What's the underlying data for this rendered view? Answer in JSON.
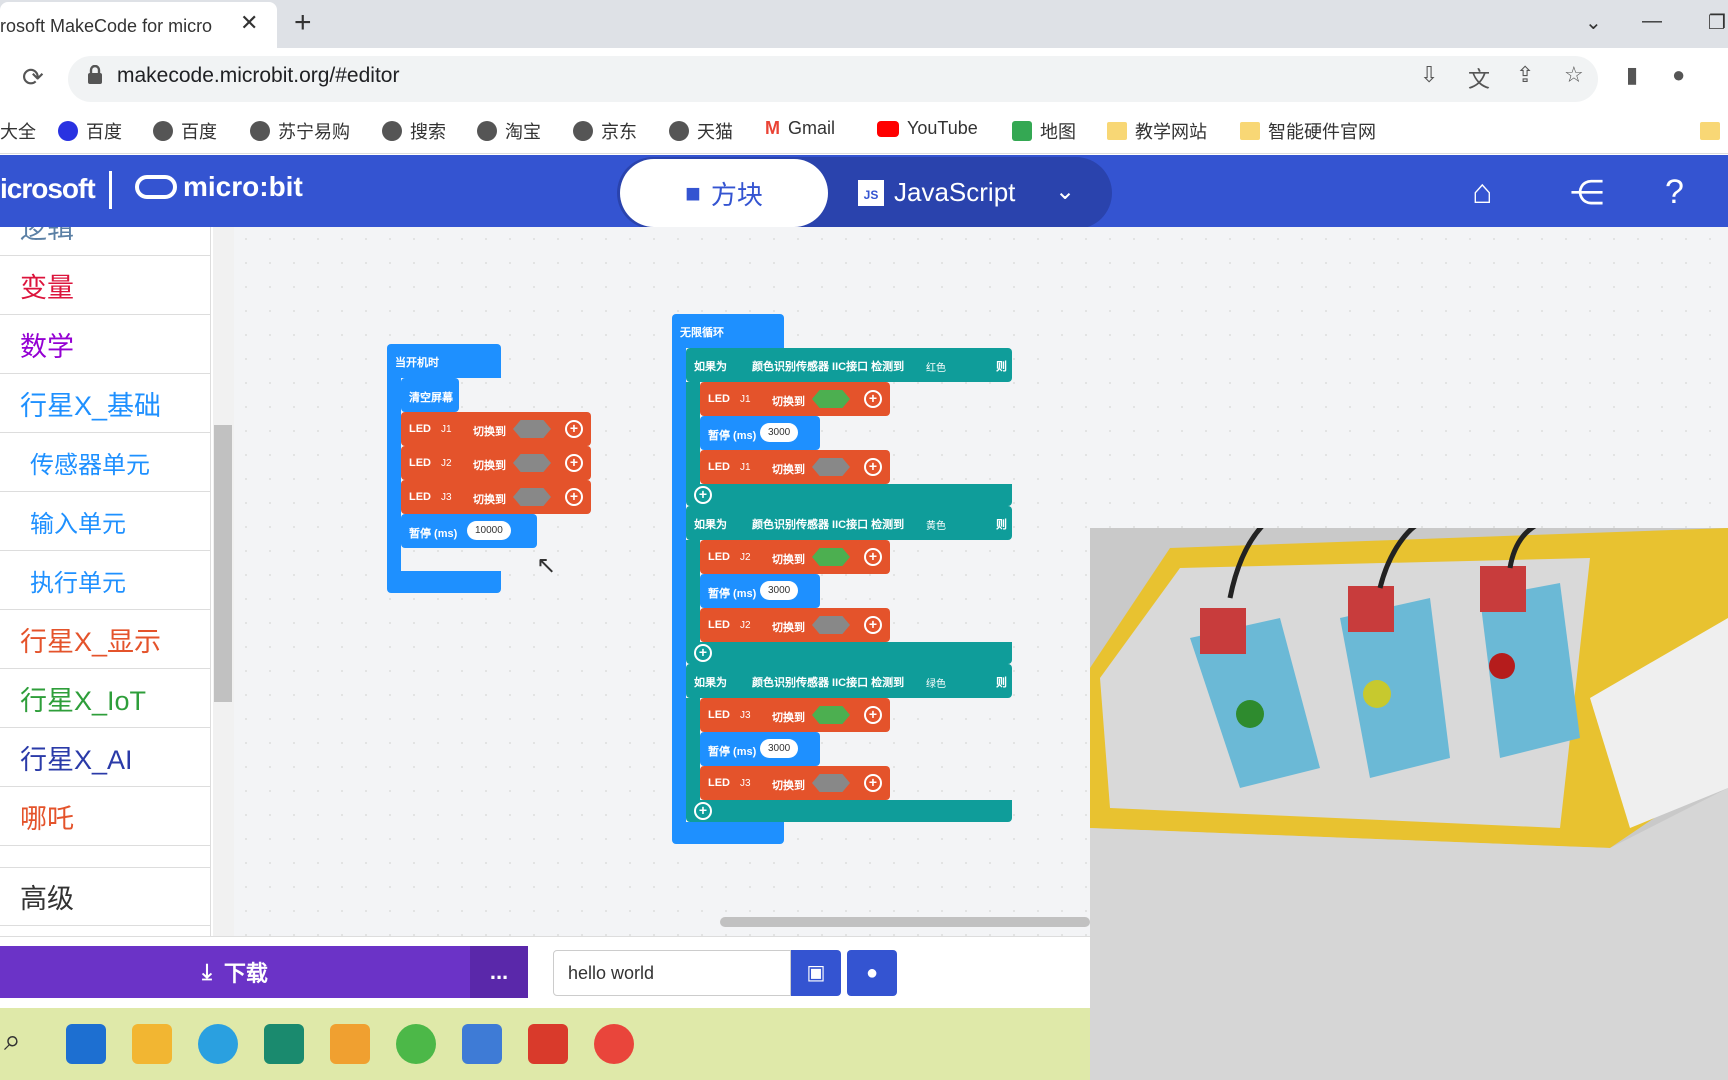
{
  "browser": {
    "tab_title": "rosoft MakeCode for micro",
    "tab_close": "✕",
    "new_tab": "+",
    "url": "makecode.microbit.org/#editor",
    "bookmarks": [
      "大全",
      "百度",
      "百度",
      "苏宁易购",
      "搜索",
      "淘宝",
      "京东",
      "天猫",
      "Gmail",
      "YouTube",
      "地图",
      "教学网站",
      "智能硬件官网"
    ]
  },
  "app_header": {
    "brand_ms": "icrosoft",
    "brand_mb": "micro:bit",
    "tab_blocks": "方块",
    "tab_js": "JavaScript",
    "js_badge": "JS"
  },
  "toolbox": {
    "categories": [
      {
        "label": "逻辑",
        "color": "#5b80a5"
      },
      {
        "label": "变量",
        "color": "#dc143c"
      },
      {
        "label": "数学",
        "color": "#9400d3"
      },
      {
        "label": "行星X_基础",
        "color": "#1e90ff"
      },
      {
        "label": "传感器单元",
        "color": "#1e90ff"
      },
      {
        "label": "输入单元",
        "color": "#1e90ff"
      },
      {
        "label": "执行单元",
        "color": "#1e90ff"
      },
      {
        "label": "行星X_显示",
        "color": "#e4532b"
      },
      {
        "label": "行星X_IoT",
        "color": "#2e9e3a"
      },
      {
        "label": "行星X_AI",
        "color": "#2a3aa8"
      },
      {
        "label": "哪吒",
        "color": "#e4532b"
      },
      {
        "label": "高级",
        "color": "#333333"
      }
    ]
  },
  "blocks": {
    "on_start": "当开机时",
    "clear": "清空屏幕",
    "led": "LED",
    "switch_to": "切换到",
    "off": "关",
    "on": "开",
    "pause": "暂停 (ms)",
    "pause_start": "10000",
    "pause_loop": "3000",
    "forever": "无限循环",
    "if": "如果为",
    "then": "则",
    "sensor": "颜色识别传感器 IIC接口 检测到",
    "colors": [
      "红色",
      "黄色",
      "绿色"
    ],
    "ports": [
      "J1",
      "J2",
      "J3"
    ]
  },
  "footer": {
    "download": "下载",
    "more": "...",
    "project_name": "hello world"
  }
}
